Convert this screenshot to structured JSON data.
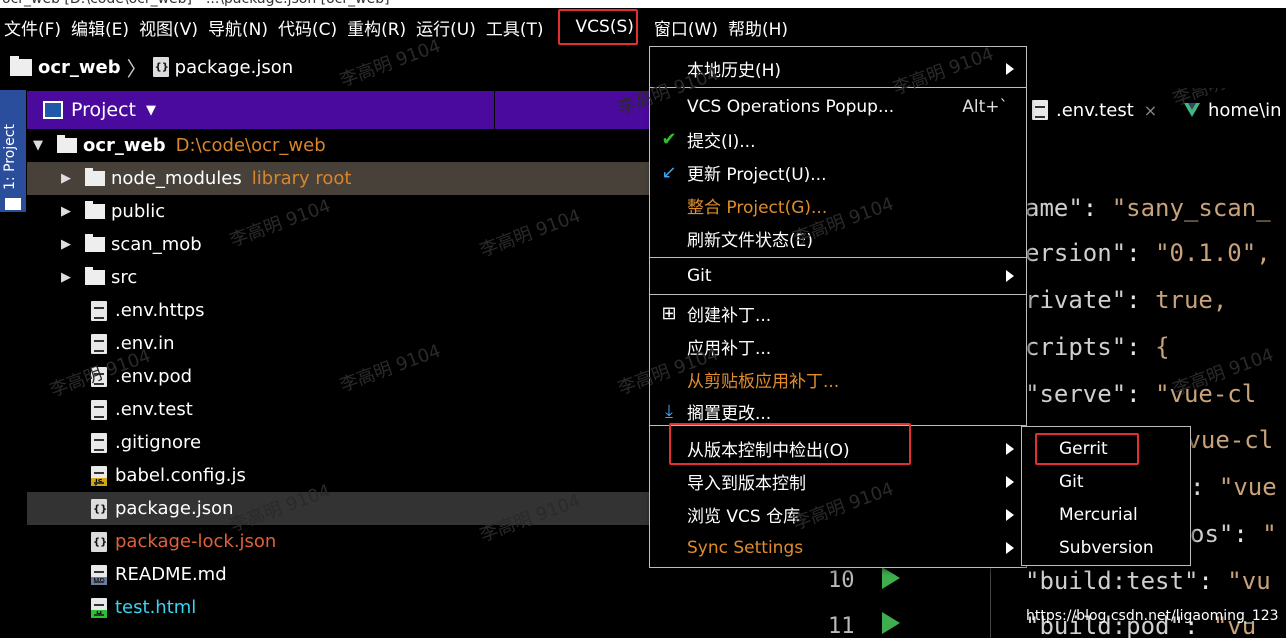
{
  "menubar": {
    "items": [
      "文件(F)",
      "编辑(E)",
      "视图(V)",
      "导航(N)",
      "代码(C)",
      "重构(R)",
      "运行(U)",
      "工具(T)",
      "VCS(S)",
      "窗口(W)",
      "帮助(H)"
    ]
  },
  "breadcrumb": {
    "project": "ocr_web",
    "file": "package.json"
  },
  "sidebar": {
    "tab_label": "1: Project"
  },
  "project_panel": {
    "title": "Project",
    "root": {
      "name": "ocr_web",
      "path": "D:\\code\\ocr_web"
    },
    "items": [
      {
        "name": "node_modules",
        "hint": "library root",
        "type": "folder"
      },
      {
        "name": "public",
        "type": "folder"
      },
      {
        "name": "scan_mob",
        "type": "folder"
      },
      {
        "name": "src",
        "type": "folder"
      },
      {
        "name": ".env.https",
        "type": "file"
      },
      {
        "name": ".env.in",
        "type": "file"
      },
      {
        "name": ".env.pod",
        "type": "file"
      },
      {
        "name": ".env.test",
        "type": "file"
      },
      {
        "name": ".gitignore",
        "type": "file"
      },
      {
        "name": "babel.config.js",
        "type": "js"
      },
      {
        "name": "package.json",
        "type": "json"
      },
      {
        "name": "package-lock.json",
        "type": "json"
      },
      {
        "name": "README.md",
        "type": "md"
      },
      {
        "name": "test.html",
        "type": "html"
      }
    ]
  },
  "editor": {
    "tabs": [
      ".env.test",
      "home\\in"
    ],
    "code_lines": [
      {
        "key": "ame\"",
        "sep": ": ",
        "val": "\"sany_scan_"
      },
      {
        "key": "ersion\"",
        "sep": ": ",
        "val": "\"0.1.0\","
      },
      {
        "key": "rivate\"",
        "sep": ": ",
        "val": "true,"
      },
      {
        "key": "cripts\"",
        "sep": ": ",
        "val": "{"
      },
      {
        "key": "\"serve\"",
        "sep": ": ",
        "val": "\"vue-cl"
      },
      {
        "key": "",
        "sep": "",
        "val": "\"vue-cl"
      },
      {
        "key": "",
        "sep": ": ",
        "val": "\"vue"
      },
      {
        "key": "os\"",
        "sep": ": ",
        "val": "\""
      },
      {
        "key": "\"build:test\"",
        "sep": ": ",
        "val": "\"vu"
      },
      {
        "key": "\"build:pod\"",
        "sep": ": ",
        "val": "\"vu"
      }
    ],
    "line_numbers": [
      "10",
      "11"
    ]
  },
  "vcs_menu": {
    "items": [
      {
        "label": "本地历史(H)",
        "submenu": true
      },
      {
        "label": "VCS Operations Popup...",
        "shortcut": "Alt+`"
      },
      {
        "label": "提交(I)...",
        "icon": "check-icon"
      },
      {
        "label": "更新 Project(U)...",
        "icon": "update-arrow-icon"
      },
      {
        "label": "整合 Project(G)...",
        "style": "orange"
      },
      {
        "label": "刷新文件状态(E)"
      },
      {
        "label": "Git",
        "submenu": true
      },
      {
        "label": "创建补丁...",
        "icon": "patch-icon"
      },
      {
        "label": "应用补丁..."
      },
      {
        "label": "从剪贴板应用补丁...",
        "style": "orange"
      },
      {
        "label": "搁置更改...",
        "icon": "shelve-icon"
      },
      {
        "label": "从版本控制中检出(O)",
        "submenu": true
      },
      {
        "label": "导入到版本控制",
        "submenu": true
      },
      {
        "label": "浏览 VCS 仓库",
        "submenu": true
      },
      {
        "label": "Sync Settings",
        "submenu": true,
        "style": "orange"
      }
    ]
  },
  "checkout_submenu": {
    "items": [
      "Gerrit",
      "Git",
      "Mercurial",
      "Subversion"
    ]
  },
  "watermark": {
    "text": "李高明 9104"
  },
  "footer": {
    "url": "https://blog.csdn.net/ligaoming_123"
  },
  "colors": {
    "project_header": "#4b0a9e",
    "highlight_red": "#e03030",
    "orange_item": "#e08c2c",
    "selected_row": "#474139"
  }
}
